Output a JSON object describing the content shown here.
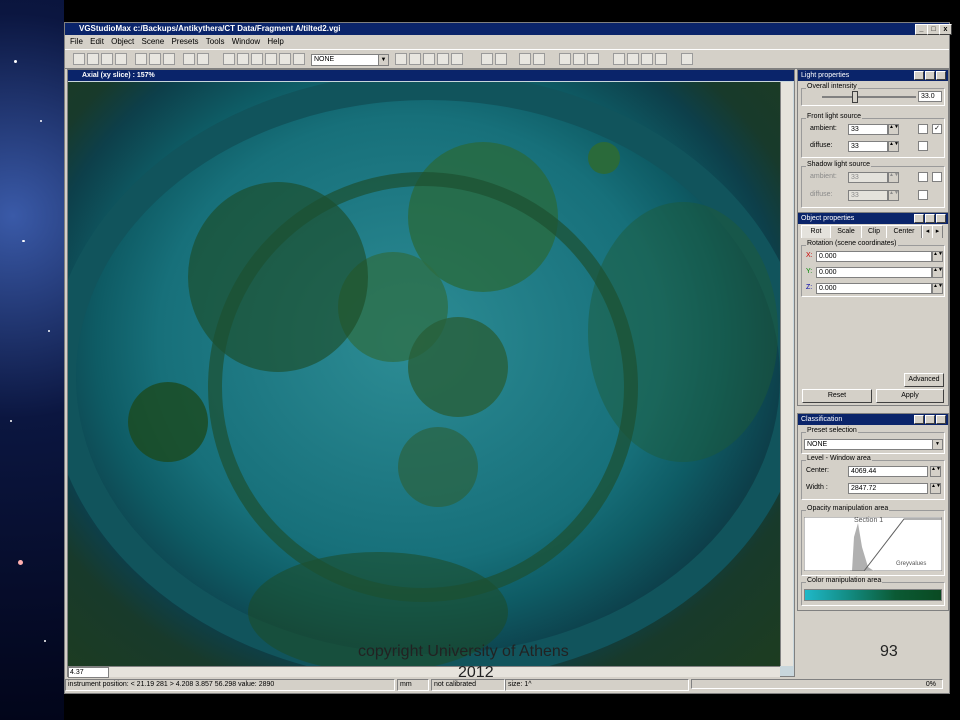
{
  "app": {
    "title": "VGStudioMax c:/Backups/Antikythera/CT Data/Fragment A/tilted2.vgi",
    "window_buttons": [
      "_",
      "□",
      "x"
    ]
  },
  "menu": [
    "File",
    "Edit",
    "Object",
    "Scene",
    "Presets",
    "Tools",
    "Window",
    "Help"
  ],
  "toolbar": {
    "preset_combo": "NONE"
  },
  "viewer": {
    "title": "Axial (xy slice) : 157%",
    "zoom_value": "4.37"
  },
  "light": {
    "title": "Light properties",
    "overall_label": "Overall intensity",
    "overall_value": "33.0",
    "front_label": "Front light source",
    "front_ambient_label": "ambient:",
    "front_ambient": "33",
    "front_diffuse_label": "diffuse:",
    "front_diffuse": "33",
    "shadow_label": "Shadow light source",
    "shadow_ambient_label": "ambient:",
    "shadow_ambient": "33",
    "shadow_diffuse_label": "diffuse:",
    "shadow_diffuse": "33"
  },
  "object": {
    "title": "Object properties",
    "tabs": [
      "Rot",
      "Scale",
      "Clip",
      "Center"
    ],
    "rotation_label": "Rotation (scene coordinates)",
    "x_label": "X:",
    "x": "0.000",
    "y_label": "Y:",
    "y": "0.000",
    "z_label": "Z:",
    "z": "0.000",
    "advanced": "Advanced",
    "reset": "Reset",
    "apply": "Apply"
  },
  "classification": {
    "title": "Classification",
    "preset_label": "Preset selection",
    "preset_value": "NONE",
    "level_label": "Level - Window area",
    "center_label": "Center:",
    "center": "4069.44",
    "width_label": "Width :",
    "width": "2847.72",
    "opacity_label": "Opacity manipulation area",
    "section_label": "Section 1",
    "grey_label": "Greyvalues",
    "color_label": "Color manipulation area"
  },
  "status": {
    "position": "instrument position: < 21.19 281 > 4.208 3.857 56.298 value: 2890",
    "unit": "mm",
    "calibration": "not calibrated",
    "size": "size: 1^",
    "percent": "0%"
  },
  "slide": {
    "copyright": "copyright University of Athens",
    "year": "2012",
    "page_number": "93"
  }
}
